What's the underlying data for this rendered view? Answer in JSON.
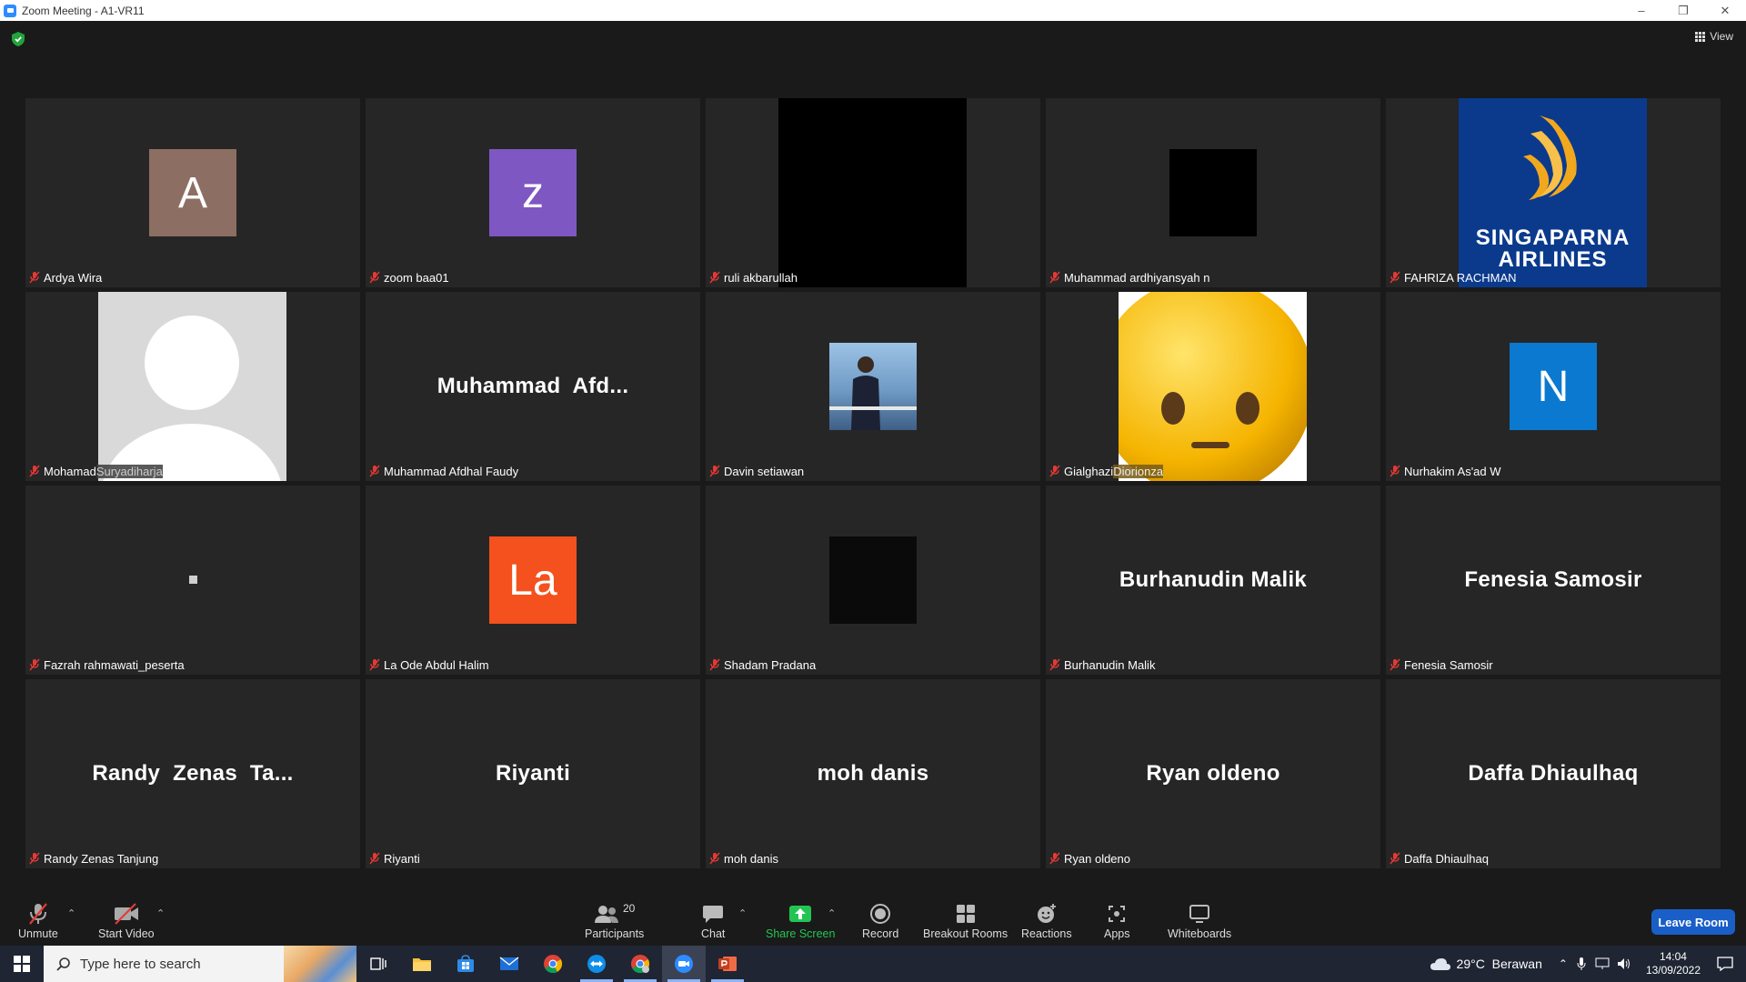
{
  "window": {
    "title": "Zoom Meeting - A1-VR11"
  },
  "header": {
    "view_label": "View"
  },
  "tiles": [
    {
      "name": "Ardya Wira",
      "avatar_letter": "A",
      "avatar_color": "#8d6e63"
    },
    {
      "name": "zoom baa01",
      "avatar_letter": "z",
      "avatar_color": "#7e57c2"
    },
    {
      "name": "ruli akbarullah"
    },
    {
      "name": "Muhammad ardhiyansyah n"
    },
    {
      "name": "FAHRIZA RACHMAN",
      "image_text": [
        "SINGAPARNA",
        "AIRLINES"
      ]
    },
    {
      "name_part1": "Mohamad",
      "name_part2": " Suryadiharja"
    },
    {
      "name": "Muhammad Afdhal Faudy",
      "display_name": "Muhammad  Afd..."
    },
    {
      "name": "Davin setiawan"
    },
    {
      "name_part1": "Gialghazi",
      "name_part2": " Diorionza"
    },
    {
      "name": "Nurhakim As'ad W",
      "avatar_letter": "N",
      "avatar_color": "#0b79d0"
    },
    {
      "name": "Fazrah rahmawati_peserta"
    },
    {
      "name": "La Ode Abdul Halim",
      "avatar_letter": "La",
      "avatar_color": "#f4511e"
    },
    {
      "name": "Shadam Pradana"
    },
    {
      "name": "Burhanudin Malik",
      "display_name": "Burhanudin Malik"
    },
    {
      "name": "Fenesia Samosir",
      "display_name": "Fenesia Samosir"
    },
    {
      "name": "Randy Zenas Tanjung",
      "display_name": "Randy  Zenas  Ta..."
    },
    {
      "name": "Riyanti",
      "display_name": "Riyanti"
    },
    {
      "name": "moh danis",
      "display_name": "moh danis"
    },
    {
      "name": "Ryan oldeno",
      "display_name": "Ryan oldeno"
    },
    {
      "name": "Daffa Dhiaulhaq",
      "display_name": "Daffa Dhiaulhaq"
    }
  ],
  "toolbar": {
    "unmute": "Unmute",
    "start_video": "Start Video",
    "participants_count": "20",
    "participants": "Participants",
    "chat": "Chat",
    "share_screen": "Share Screen",
    "record": "Record",
    "breakout_rooms": "Breakout Rooms",
    "reactions": "Reactions",
    "apps": "Apps",
    "whiteboards": "Whiteboards",
    "leave_room": "Leave Room"
  },
  "taskbar": {
    "search_placeholder": "Type here to search",
    "weather": "29°C  Berawan",
    "time": "14:04",
    "date": "13/09/2022"
  }
}
